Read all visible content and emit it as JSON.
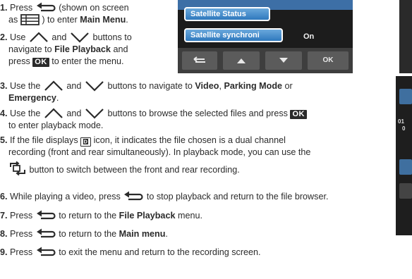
{
  "device_screen": {
    "menu_items": [
      {
        "label": "Satellite Status",
        "value": ""
      },
      {
        "label": "Satellite synchroni",
        "value": "On"
      }
    ],
    "bar_buttons": [
      {
        "name": "back-button",
        "label": ""
      },
      {
        "name": "up-button",
        "label": ""
      },
      {
        "name": "down-button",
        "label": ""
      },
      {
        "name": "ok-button",
        "label": "OK"
      }
    ]
  },
  "side_screen": {
    "labels": [
      "01",
      "0"
    ]
  },
  "steps": {
    "s1": {
      "num": "1.",
      "t1": "Press",
      "t2": "(shown on screen",
      "t3": "as",
      "t4": ") to enter",
      "b1": "Main Menu",
      "t5": "."
    },
    "s2": {
      "num": "2.",
      "t1": "Use",
      "t2": "and",
      "t3": "buttons to",
      "t4": "navigate to",
      "b1": "File Playback",
      "t5": "and",
      "t6": "press",
      "ok": "OK",
      "t7": "to enter the menu."
    },
    "s3": {
      "num": "3.",
      "t1": "Use the",
      "t2": "and",
      "t3": "buttons to navigate to",
      "b1": "Video",
      "t4": ",",
      "b2": "Parking Mode",
      "t5": "or",
      "b3": "Emergency",
      "t6": "."
    },
    "s4": {
      "num": "4.",
      "t1": "Use the",
      "t2": "and",
      "t3": "buttons to browse the selected files and press",
      "ok": "OK",
      "t4": "to enter playback mode."
    },
    "s5": {
      "num": "5.",
      "t1": "If the file displays",
      "d": "D",
      "t2": "icon, it indicates the file chosen is a dual channel",
      "t3": "recording (front and rear simultaneously). In playback mode, you can use the",
      "t4": "button to switch between the front and rear recording."
    },
    "s6": {
      "num": "6.",
      "t1": "While playing a video, press",
      "t2": "to stop playback and return to the file browser."
    },
    "s7": {
      "num": "7.",
      "t1": "Press",
      "t2": "to return to the",
      "b1": "File Playback",
      "t3": "menu."
    },
    "s8": {
      "num": "8.",
      "t1": "Press",
      "t2": "to return to the",
      "b1": "Main menu",
      "t3": "."
    },
    "s9": {
      "num": "9.",
      "t1": "Press",
      "t2": "to exit the menu and return to the recording screen."
    }
  }
}
